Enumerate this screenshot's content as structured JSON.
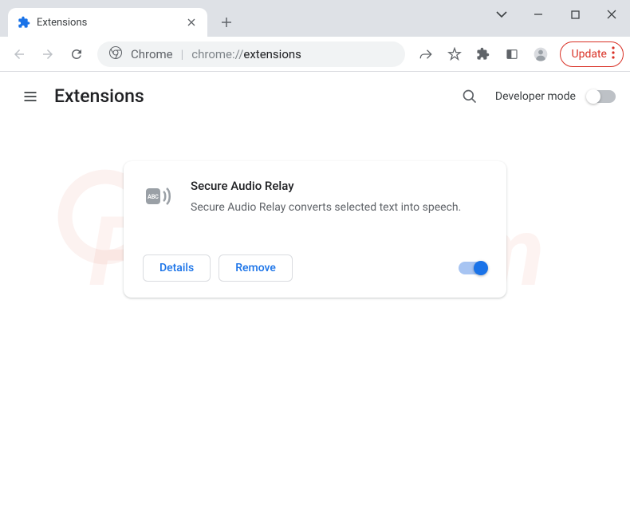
{
  "window": {
    "tab_title": "Extensions",
    "omnibox": {
      "chrome_label": "Chrome",
      "url_scheme": "chrome://",
      "url_path": "extensions"
    },
    "update_label": "Update"
  },
  "page": {
    "title": "Extensions",
    "dev_mode_label": "Developer mode",
    "dev_mode_on": false
  },
  "extension": {
    "name": "Secure Audio Relay",
    "description": "Secure Audio Relay converts selected text into speech.",
    "details_label": "Details",
    "remove_label": "Remove",
    "enabled": true
  },
  "watermark": "PCrisk.com"
}
